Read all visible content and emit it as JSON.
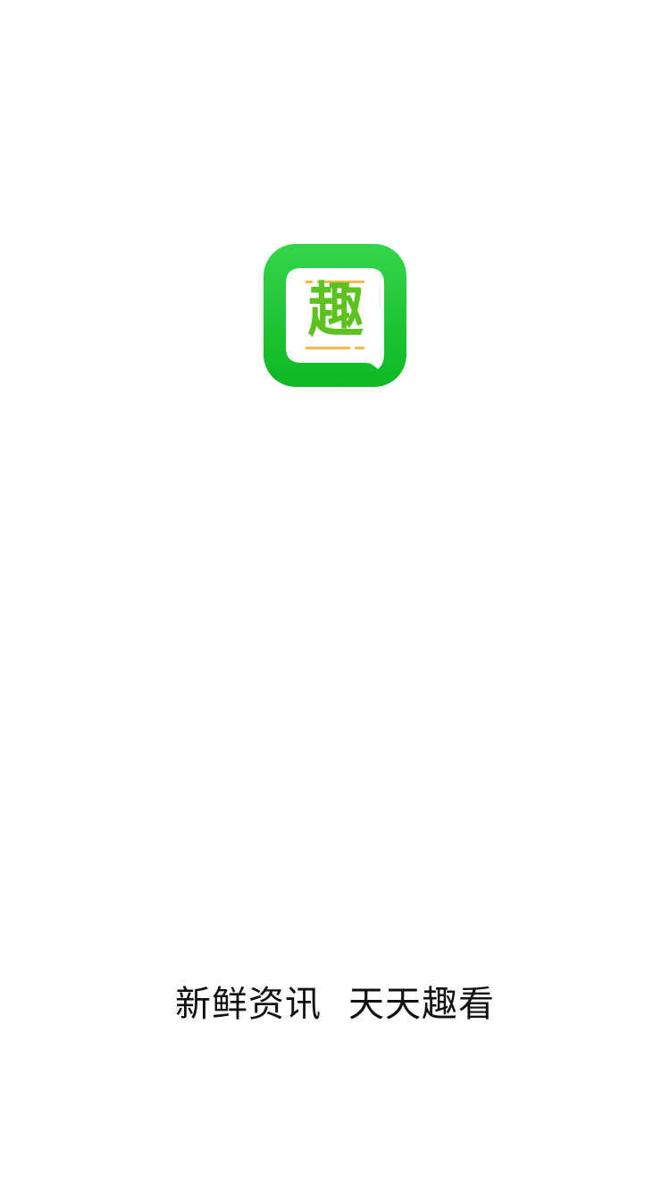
{
  "splash": {
    "logo": {
      "icon": "chat-bubble-logo-icon",
      "char": "趣",
      "colors": {
        "bg_top": "#35d54a",
        "bg_bottom": "#0db823",
        "bubble": "#ffffff",
        "char": "#5cc21f",
        "accent_lines": "#f5b94a"
      }
    },
    "slogan": {
      "part1": "新鲜资讯",
      "part2": "天天趣看"
    }
  }
}
